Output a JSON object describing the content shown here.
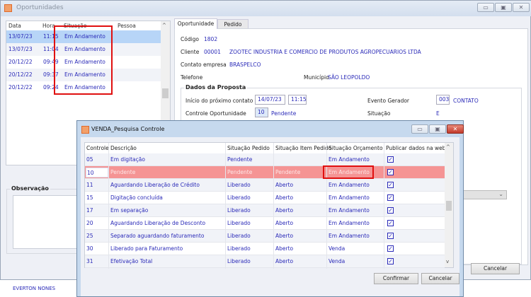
{
  "main_window": {
    "title": "Oportunidades",
    "minimize": "▭",
    "maximize": "▣",
    "close": "✕"
  },
  "list": {
    "headers": [
      "Data",
      "Hora",
      "Situação",
      "Pessoa"
    ],
    "rows": [
      {
        "data": "13/07/23",
        "hora": "11:15",
        "situacao": "Em Andamento"
      },
      {
        "data": "13/07/23",
        "hora": "11:04",
        "situacao": "Em Andamento"
      },
      {
        "data": "20/12/22",
        "hora": "09:49",
        "situacao": "Em Andamento"
      },
      {
        "data": "20/12/22",
        "hora": "09:37",
        "situacao": "Em Andamento"
      },
      {
        "data": "20/12/22",
        "hora": "09:24",
        "situacao": "Em Andamento"
      }
    ]
  },
  "tabs": [
    "Oportunidade",
    "Pedido"
  ],
  "form": {
    "codigo_label": "Código",
    "codigo": "1802",
    "cliente_label": "Cliente",
    "cliente_cod": "00001",
    "cliente_nome": "ZOOTEC INDUSTRIA E COMERCIO DE PRODUTOS AGROPECUARIOS LTDA",
    "contato_label": "Contato empresa",
    "contato": "BRASPELCO",
    "telefone_label": "Telefone",
    "municipio_label": "Município",
    "municipio": "SÃO LEOPOLDO",
    "group_title": "Dados da Proposta",
    "inicio_label": "Início do próximo contato",
    "inicio_data": "14/07/23",
    "inicio_hora": "11:15",
    "evento_label": "Evento Gerador",
    "evento_cod": "003",
    "evento": "CONTATO",
    "controle_label": "Controle Oportunidade",
    "controle_cod": "10",
    "controle": "Pendente",
    "situacao_label": "Situação",
    "situacao": "E"
  },
  "observacao_label": "Observação",
  "bottom_text": "EVERTON NONES",
  "main_cancel": "Cancelar",
  "dialog": {
    "title": "VENDA_Pesquisa Controle",
    "minimize": "▭",
    "maximize": "▣",
    "close": "✕",
    "headers": [
      "Controle",
      "Descrição",
      "Situação Pedido",
      "Situação Item Pedido",
      "Situação Orçamento",
      "Publicar dados na web"
    ],
    "rows": [
      {
        "c": "05",
        "d": "Em digitação",
        "sp": "Pendente",
        "si": "",
        "so": "Em Andamento",
        "web": true
      },
      {
        "c": "10",
        "d": "Pendente",
        "sp": "Pendente",
        "si": "Pendente",
        "so": "Em Andamento",
        "web": true
      },
      {
        "c": "11",
        "d": "Aguardando Liberação de Crédito",
        "sp": "Liberado",
        "si": "Aberto",
        "so": "Em Andamento",
        "web": true
      },
      {
        "c": "15",
        "d": "Digitação concluída",
        "sp": "Liberado",
        "si": "Aberto",
        "so": "Em Andamento",
        "web": true
      },
      {
        "c": "17",
        "d": "Em separação",
        "sp": "Liberado",
        "si": "Aberto",
        "so": "Em Andamento",
        "web": true
      },
      {
        "c": "20",
        "d": "Aguardando Liberação de Desconto",
        "sp": "Liberado",
        "si": "Aberto",
        "so": "Em Andamento",
        "web": true
      },
      {
        "c": "25",
        "d": "Separado aguardando faturamento",
        "sp": "Liberado",
        "si": "Aberto",
        "so": "Em Andamento",
        "web": true
      },
      {
        "c": "30",
        "d": "Liberado para Faturamento",
        "sp": "Liberado",
        "si": "Aberto",
        "so": "Venda",
        "web": true
      },
      {
        "c": "31",
        "d": "Efetivação Total",
        "sp": "Liberado",
        "si": "Aberto",
        "so": "Venda",
        "web": true
      }
    ],
    "confirm": "Confirmar",
    "cancel": "Cancelar"
  },
  "colors": {
    "highlight": "#f59494",
    "accent_text": "#2a2ab8",
    "annotation": "#e01010"
  }
}
